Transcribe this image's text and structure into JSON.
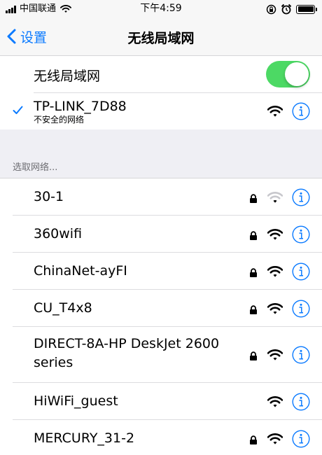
{
  "status_bar": {
    "carrier": "中国联通",
    "time": "下午4:59",
    "icons": [
      "signal-icon",
      "wifi-icon",
      "rotation-lock-icon",
      "alarm-icon",
      "battery-icon"
    ]
  },
  "nav": {
    "back_label": "设置",
    "title": "无线局域网"
  },
  "wifi_toggle": {
    "label": "无线局域网",
    "on": true
  },
  "connected": {
    "name": "TP-LINK_7D88",
    "subtitle": "不安全的网络",
    "locked": false,
    "signal": "full"
  },
  "section_header": "选取网络...",
  "networks": [
    {
      "name": "30-1",
      "locked": true,
      "signal": "weak"
    },
    {
      "name": "360wifi",
      "locked": true,
      "signal": "full"
    },
    {
      "name": "ChinaNet-ayFI",
      "locked": true,
      "signal": "full"
    },
    {
      "name": "CU_T4x8",
      "locked": true,
      "signal": "full"
    },
    {
      "name": "DIRECT-8A-HP DeskJet 2600",
      "name_line2": "series",
      "locked": true,
      "signal": "full"
    },
    {
      "name": "HiWiFi_guest",
      "locked": false,
      "signal": "full"
    },
    {
      "name": "MERCURY_31-2",
      "locked": true,
      "signal": "full"
    }
  ],
  "colors": {
    "accent": "#0a7aff",
    "toggle_on": "#4cd964",
    "group_background": "#efeff4",
    "bar_background": "#f7f7f7"
  }
}
